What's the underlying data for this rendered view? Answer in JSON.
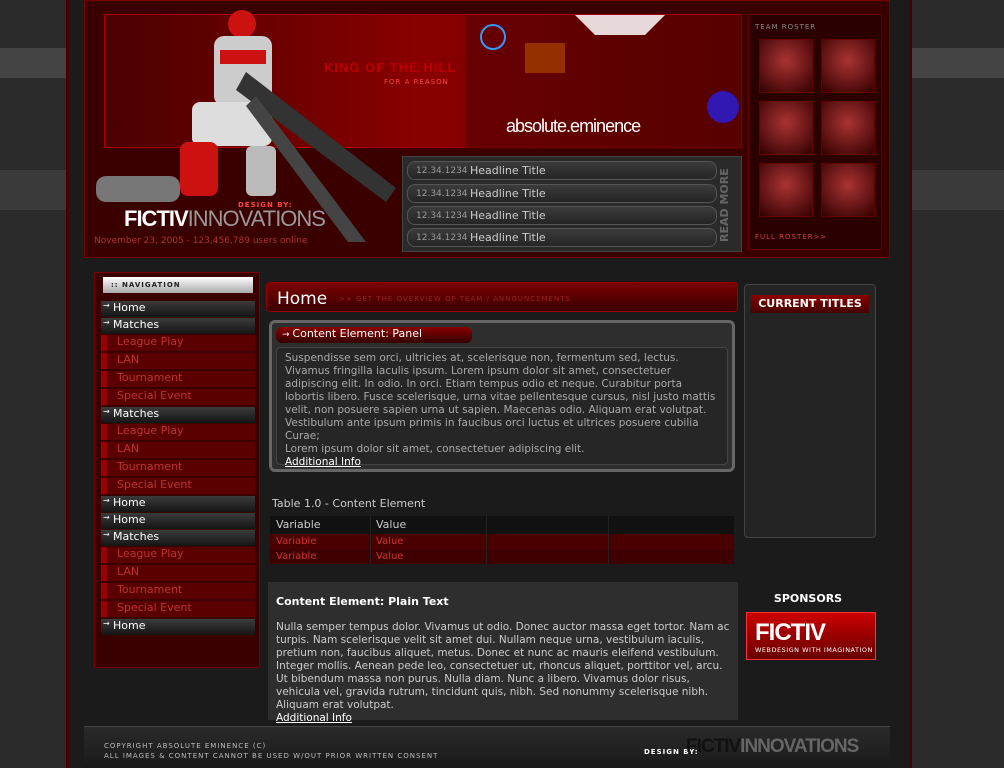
{
  "header": {
    "banner_tagline": "KING OF THE HILL",
    "banner_subtagline": "FOR A REASON",
    "brand": "absolute.eminence",
    "design_tag": "DESIGN BY:",
    "logo_primary": "FICTIV",
    "logo_secondary": "INNOVATIONS",
    "stats": "November 23, 2005 - 123,456,789 users online",
    "read_more": "READ MORE"
  },
  "headlines": [
    {
      "date": "12.34.1234",
      "title": "Headline Title"
    },
    {
      "date": "12.34.1234",
      "title": "Headline Title"
    },
    {
      "date": "12.34.1234",
      "title": "Headline Title"
    },
    {
      "date": "12.34.1234",
      "title": "Headline Title"
    }
  ],
  "roster": {
    "title": "TEAM ROSTER",
    "link": "FULL ROSTER>>"
  },
  "nav": {
    "title": ":: NAVIGATION",
    "items": [
      {
        "label": "Home",
        "type": "main"
      },
      {
        "label": "Matches",
        "type": "main"
      },
      {
        "label": "League Play",
        "type": "sub"
      },
      {
        "label": "LAN",
        "type": "sub"
      },
      {
        "label": "Tournament",
        "type": "sub"
      },
      {
        "label": "Special Event",
        "type": "sub"
      },
      {
        "label": "Matches",
        "type": "main"
      },
      {
        "label": "League Play",
        "type": "sub"
      },
      {
        "label": "LAN",
        "type": "sub"
      },
      {
        "label": "Tournament",
        "type": "sub"
      },
      {
        "label": "Special Event",
        "type": "sub"
      },
      {
        "label": "Home",
        "type": "main"
      },
      {
        "label": "Home",
        "type": "main"
      },
      {
        "label": "Matches",
        "type": "main"
      },
      {
        "label": "League Play",
        "type": "sub"
      },
      {
        "label": "LAN",
        "type": "sub"
      },
      {
        "label": "Tournament",
        "type": "sub"
      },
      {
        "label": "Special Event",
        "type": "sub"
      },
      {
        "label": "Home",
        "type": "main"
      }
    ]
  },
  "main": {
    "title": "Home",
    "subtitle": ">> GET THE OVERVIEW OF TEAM / ANNOUNCEMENTS",
    "panel": {
      "title": "Content Element: Panel",
      "body": "Suspendisse sem orci, ultricies at, scelerisque non, fermentum sed, lectus. Vivamus fringilla iaculis ipsum. Lorem ipsum dolor sit amet, consectetuer adipiscing elit. In odio. In orci. Etiam tempus odio et neque. Curabitur porta lobortis libero. Fusce scelerisque, urna vitae pellentesque cursus, nisl justo mattis velit, non posuere sapien urna ut sapien. Maecenas odio. Aliquam erat volutpat. Vestibulum ante ipsum primis in faucibus orci luctus et ultrices posuere cubilia Curae;",
      "body2": "Lorem ipsum dolor sit amet, consectetuer adipiscing elit.",
      "link": "Additional Info"
    },
    "table": {
      "caption": "Table 1.0 - Content Element",
      "headers": [
        "Variable",
        "Value",
        "",
        ""
      ],
      "rows": [
        [
          "Variable",
          "Value",
          "",
          ""
        ],
        [
          "Variable",
          "Value",
          "",
          ""
        ]
      ]
    },
    "plain": {
      "title": "Content Element: Plain Text",
      "body": "Nulla semper tempus dolor. Vivamus ut odio. Donec auctor massa eget tortor. Nam ac turpis. Nam scelerisque velit sit amet dui. Nullam neque urna, vestibulum iaculis, pretium non, faucibus aliquet, metus. Donec et nunc ac mauris eleifend vestibulum. Integer mollis. Aenean pede leo, consectetuer ut, rhoncus aliquet, porttitor vel, arcu. Ut bibendum massa non purus. Nulla diam. Nunc a libero. Vivamus dolor risus, vehicula vel, gravida rutrum, tincidunt quis, nibh. Sed nonummy scelerisque nibh. Aliquam erat volutpat.",
      "link": "Additional Info"
    }
  },
  "sidebar": {
    "titles_header": "CURRENT TITLES",
    "sponsors_title": "SPONSORS",
    "sponsor_name": "FICTIV",
    "sponsor_tagline": "WEBDESIGN WITH IMAGINATION"
  },
  "footer": {
    "copyright": "COPYRIGHT ABSOLUTE EMINENCE (C)",
    "notice": "ALL IMAGES & CONTENT CANNOT BE USED W/OUT PRIOR WRITTEN CONSENT",
    "design_by": "DESIGN BY:",
    "logo_primary": "FICTIV",
    "logo_secondary": "INNOVATIONS"
  },
  "colors": {
    "accent": "#990000",
    "background": "#1b1b1b"
  }
}
